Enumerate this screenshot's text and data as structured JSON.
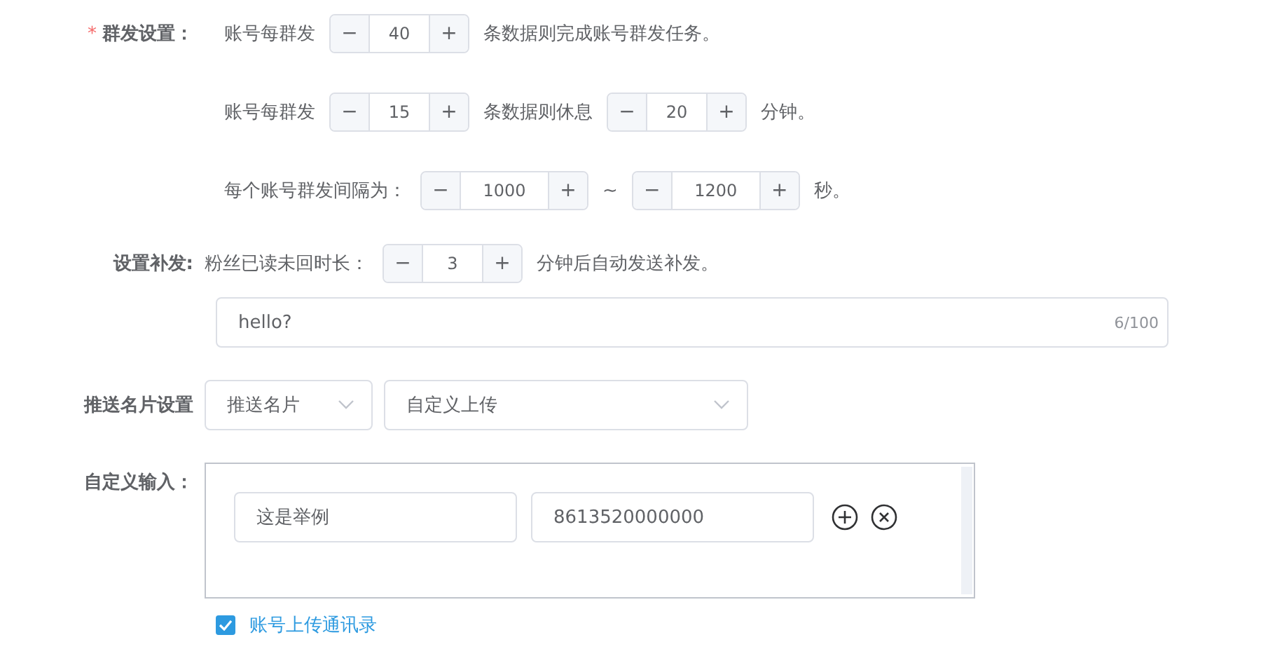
{
  "mass_send": {
    "label": "群发设置：",
    "required_mark": "*",
    "lines": [
      {
        "parts": [
          {
            "kind": "text",
            "text": "账号每群发"
          },
          {
            "kind": "stepper",
            "minus": "−",
            "value": "40",
            "plus": "+"
          },
          {
            "kind": "text",
            "text": "条数据则完成账号群发任务。"
          }
        ]
      },
      {
        "parts": [
          {
            "kind": "text",
            "text": "账号每群发"
          },
          {
            "kind": "stepper",
            "minus": "−",
            "value": "15",
            "plus": "+"
          },
          {
            "kind": "text",
            "text": "条数据则休息"
          },
          {
            "kind": "stepper",
            "minus": "−",
            "value": "20",
            "plus": "+"
          },
          {
            "kind": "text",
            "text": "分钟。"
          }
        ]
      },
      {
        "parts": [
          {
            "kind": "text",
            "text": "每个账号群发间隔为："
          },
          {
            "kind": "stepper",
            "minus": "−",
            "value": "1000",
            "plus": "+"
          },
          {
            "kind": "text",
            "text": "~"
          },
          {
            "kind": "stepper",
            "minus": "−",
            "value": "1200",
            "plus": "+"
          },
          {
            "kind": "text",
            "text": "秒。"
          }
        ]
      }
    ]
  },
  "followup": {
    "label": "设置补发:",
    "parts": [
      {
        "kind": "text",
        "text": "粉丝已读未回时长："
      },
      {
        "kind": "stepper",
        "minus": "−",
        "value": "3",
        "plus": "+"
      },
      {
        "kind": "text",
        "text": "分钟后自动发送补发。"
      }
    ],
    "message": {
      "value": "hello?",
      "counter": "6/100"
    }
  },
  "card_push": {
    "label": "推送名片设置",
    "selects": [
      {
        "value": "推送名片"
      },
      {
        "value": "自定义上传"
      }
    ]
  },
  "custom_input": {
    "label": "自定义输入：",
    "fields": [
      {
        "value": "这是举例"
      },
      {
        "value": "8613520000000"
      }
    ]
  },
  "upload_contacts": {
    "label": "账号上传通讯录",
    "checked": true
  }
}
